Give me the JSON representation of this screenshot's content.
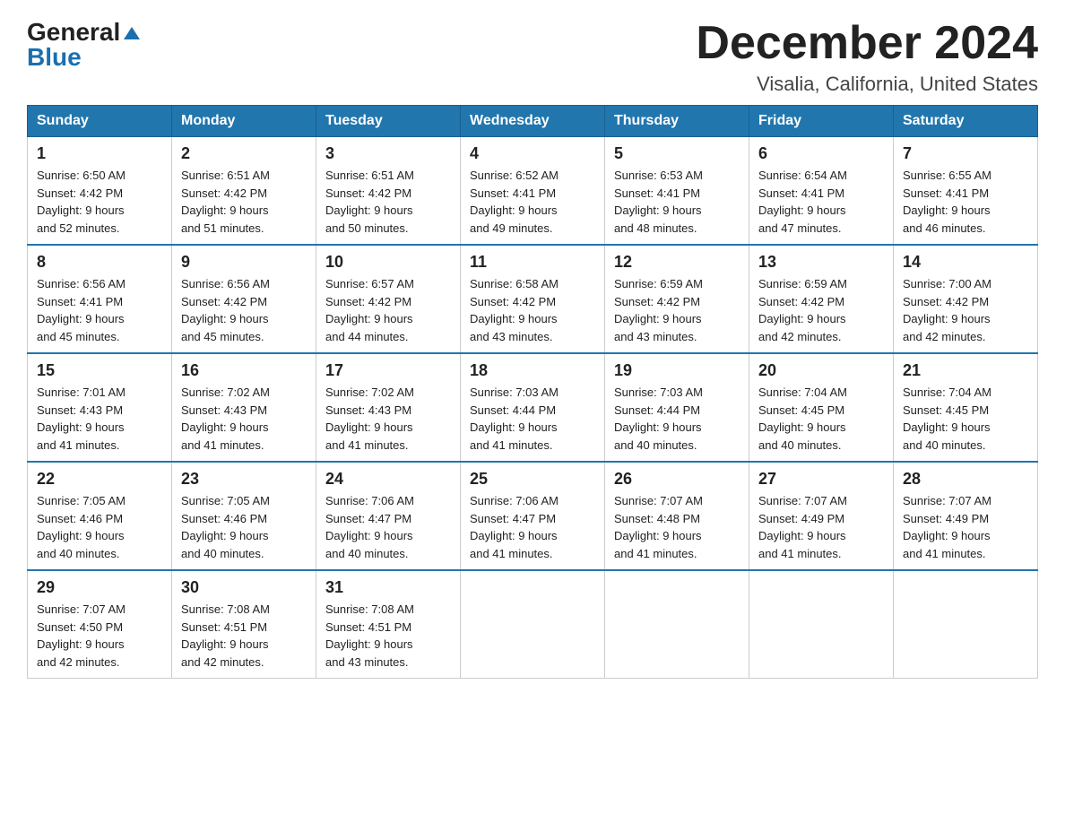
{
  "header": {
    "logo_general": "General",
    "logo_blue": "Blue",
    "main_title": "December 2024",
    "subtitle": "Visalia, California, United States"
  },
  "days_of_week": [
    "Sunday",
    "Monday",
    "Tuesday",
    "Wednesday",
    "Thursday",
    "Friday",
    "Saturday"
  ],
  "weeks": [
    [
      {
        "day": "1",
        "sunrise": "6:50 AM",
        "sunset": "4:42 PM",
        "daylight": "9 hours and 52 minutes."
      },
      {
        "day": "2",
        "sunrise": "6:51 AM",
        "sunset": "4:42 PM",
        "daylight": "9 hours and 51 minutes."
      },
      {
        "day": "3",
        "sunrise": "6:51 AM",
        "sunset": "4:42 PM",
        "daylight": "9 hours and 50 minutes."
      },
      {
        "day": "4",
        "sunrise": "6:52 AM",
        "sunset": "4:41 PM",
        "daylight": "9 hours and 49 minutes."
      },
      {
        "day": "5",
        "sunrise": "6:53 AM",
        "sunset": "4:41 PM",
        "daylight": "9 hours and 48 minutes."
      },
      {
        "day": "6",
        "sunrise": "6:54 AM",
        "sunset": "4:41 PM",
        "daylight": "9 hours and 47 minutes."
      },
      {
        "day": "7",
        "sunrise": "6:55 AM",
        "sunset": "4:41 PM",
        "daylight": "9 hours and 46 minutes."
      }
    ],
    [
      {
        "day": "8",
        "sunrise": "6:56 AM",
        "sunset": "4:41 PM",
        "daylight": "9 hours and 45 minutes."
      },
      {
        "day": "9",
        "sunrise": "6:56 AM",
        "sunset": "4:42 PM",
        "daylight": "9 hours and 45 minutes."
      },
      {
        "day": "10",
        "sunrise": "6:57 AM",
        "sunset": "4:42 PM",
        "daylight": "9 hours and 44 minutes."
      },
      {
        "day": "11",
        "sunrise": "6:58 AM",
        "sunset": "4:42 PM",
        "daylight": "9 hours and 43 minutes."
      },
      {
        "day": "12",
        "sunrise": "6:59 AM",
        "sunset": "4:42 PM",
        "daylight": "9 hours and 43 minutes."
      },
      {
        "day": "13",
        "sunrise": "6:59 AM",
        "sunset": "4:42 PM",
        "daylight": "9 hours and 42 minutes."
      },
      {
        "day": "14",
        "sunrise": "7:00 AM",
        "sunset": "4:42 PM",
        "daylight": "9 hours and 42 minutes."
      }
    ],
    [
      {
        "day": "15",
        "sunrise": "7:01 AM",
        "sunset": "4:43 PM",
        "daylight": "9 hours and 41 minutes."
      },
      {
        "day": "16",
        "sunrise": "7:02 AM",
        "sunset": "4:43 PM",
        "daylight": "9 hours and 41 minutes."
      },
      {
        "day": "17",
        "sunrise": "7:02 AM",
        "sunset": "4:43 PM",
        "daylight": "9 hours and 41 minutes."
      },
      {
        "day": "18",
        "sunrise": "7:03 AM",
        "sunset": "4:44 PM",
        "daylight": "9 hours and 41 minutes."
      },
      {
        "day": "19",
        "sunrise": "7:03 AM",
        "sunset": "4:44 PM",
        "daylight": "9 hours and 40 minutes."
      },
      {
        "day": "20",
        "sunrise": "7:04 AM",
        "sunset": "4:45 PM",
        "daylight": "9 hours and 40 minutes."
      },
      {
        "day": "21",
        "sunrise": "7:04 AM",
        "sunset": "4:45 PM",
        "daylight": "9 hours and 40 minutes."
      }
    ],
    [
      {
        "day": "22",
        "sunrise": "7:05 AM",
        "sunset": "4:46 PM",
        "daylight": "9 hours and 40 minutes."
      },
      {
        "day": "23",
        "sunrise": "7:05 AM",
        "sunset": "4:46 PM",
        "daylight": "9 hours and 40 minutes."
      },
      {
        "day": "24",
        "sunrise": "7:06 AM",
        "sunset": "4:47 PM",
        "daylight": "9 hours and 40 minutes."
      },
      {
        "day": "25",
        "sunrise": "7:06 AM",
        "sunset": "4:47 PM",
        "daylight": "9 hours and 41 minutes."
      },
      {
        "day": "26",
        "sunrise": "7:07 AM",
        "sunset": "4:48 PM",
        "daylight": "9 hours and 41 minutes."
      },
      {
        "day": "27",
        "sunrise": "7:07 AM",
        "sunset": "4:49 PM",
        "daylight": "9 hours and 41 minutes."
      },
      {
        "day": "28",
        "sunrise": "7:07 AM",
        "sunset": "4:49 PM",
        "daylight": "9 hours and 41 minutes."
      }
    ],
    [
      {
        "day": "29",
        "sunrise": "7:07 AM",
        "sunset": "4:50 PM",
        "daylight": "9 hours and 42 minutes."
      },
      {
        "day": "30",
        "sunrise": "7:08 AM",
        "sunset": "4:51 PM",
        "daylight": "9 hours and 42 minutes."
      },
      {
        "day": "31",
        "sunrise": "7:08 AM",
        "sunset": "4:51 PM",
        "daylight": "9 hours and 43 minutes."
      },
      null,
      null,
      null,
      null
    ]
  ],
  "labels": {
    "sunrise": "Sunrise:",
    "sunset": "Sunset:",
    "daylight": "Daylight:"
  }
}
